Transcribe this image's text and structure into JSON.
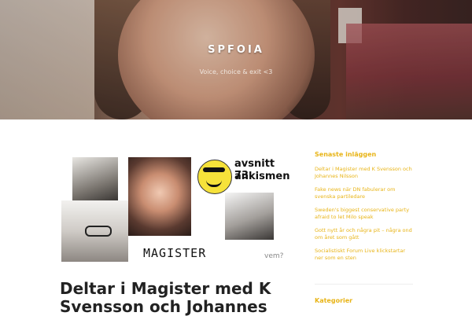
{
  "site": {
    "title": "SPFOIA",
    "description": "Voice, choice & exit <3"
  },
  "post": {
    "title": "Deltar i Magister med K Svensson och Johannes",
    "image": {
      "episode_line1": "avsnitt 73",
      "episode_line2": "ankismen",
      "logo_text": "MAGISTER",
      "vem_text": "vem?"
    }
  },
  "sidebar": {
    "recent_title": "Senaste inläggen",
    "recent_posts": [
      "Deltar i Magister med K Svensson och Johannes Nilsson",
      "Fake news när DN fabulerar om svenska partiledare",
      "Sweden's biggest conservative party afraid to let Milo speak",
      "Gott nytt år och några pit – några ond om året som gått",
      "Socialistiskt Forum Live klickstartar ner som en sten"
    ],
    "categories_title": "Kategorier"
  },
  "colors": {
    "accent": "#e8b417",
    "title_text": "#222222"
  }
}
